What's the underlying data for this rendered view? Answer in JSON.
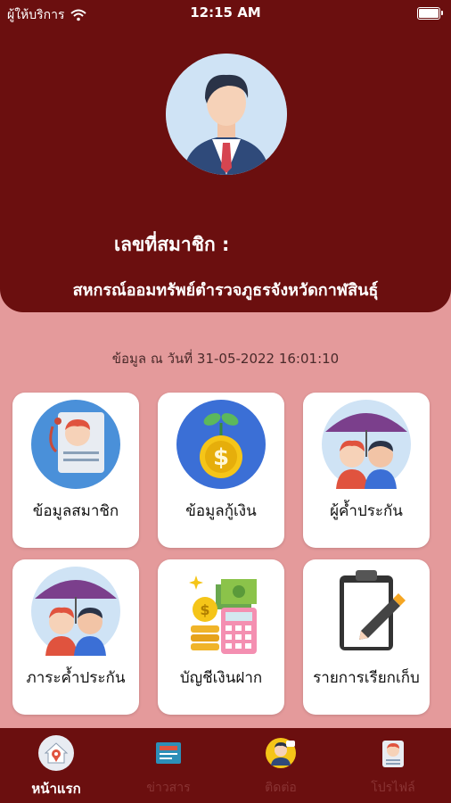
{
  "status_bar": {
    "carrier": "ผู้ให้บริการ",
    "time": "12:15 AM"
  },
  "header": {
    "member_number_label": "เลขที่สมาชิก :",
    "coop_name": "สหกรณ์ออมทรัพย์ตำรวจภูธรจังหวัดกาฬสินธุ์"
  },
  "as_of": "ข้อมูล ณ วันที่ 31-05-2022 16:01:10",
  "menu": [
    {
      "label": "ข้อมูลสมาชิก",
      "icon": "member-card-icon"
    },
    {
      "label": "ข้อมูลกู้เงิน",
      "icon": "money-plant-icon"
    },
    {
      "label": "ผู้ค้ำประกัน",
      "icon": "guarantor-umbrella-icon"
    },
    {
      "label": "ภาระค้ำประกัน",
      "icon": "guarantee-burden-icon"
    },
    {
      "label": "บัญชีเงินฝาก",
      "icon": "deposit-account-icon"
    },
    {
      "label": "รายการเรียกเก็บ",
      "icon": "billing-clipboard-icon"
    }
  ],
  "tabs": [
    {
      "label": "หน้าแรก",
      "icon": "home-icon"
    },
    {
      "label": "ข่าวสาร",
      "icon": "news-icon"
    },
    {
      "label": "ติดต่อ",
      "icon": "contact-icon"
    },
    {
      "label": "โปรไฟล์",
      "icon": "profile-icon"
    }
  ],
  "colors": {
    "header_bg": "#6b0f0f",
    "page_bg": "#e49a9b",
    "card_bg": "#ffffff"
  }
}
